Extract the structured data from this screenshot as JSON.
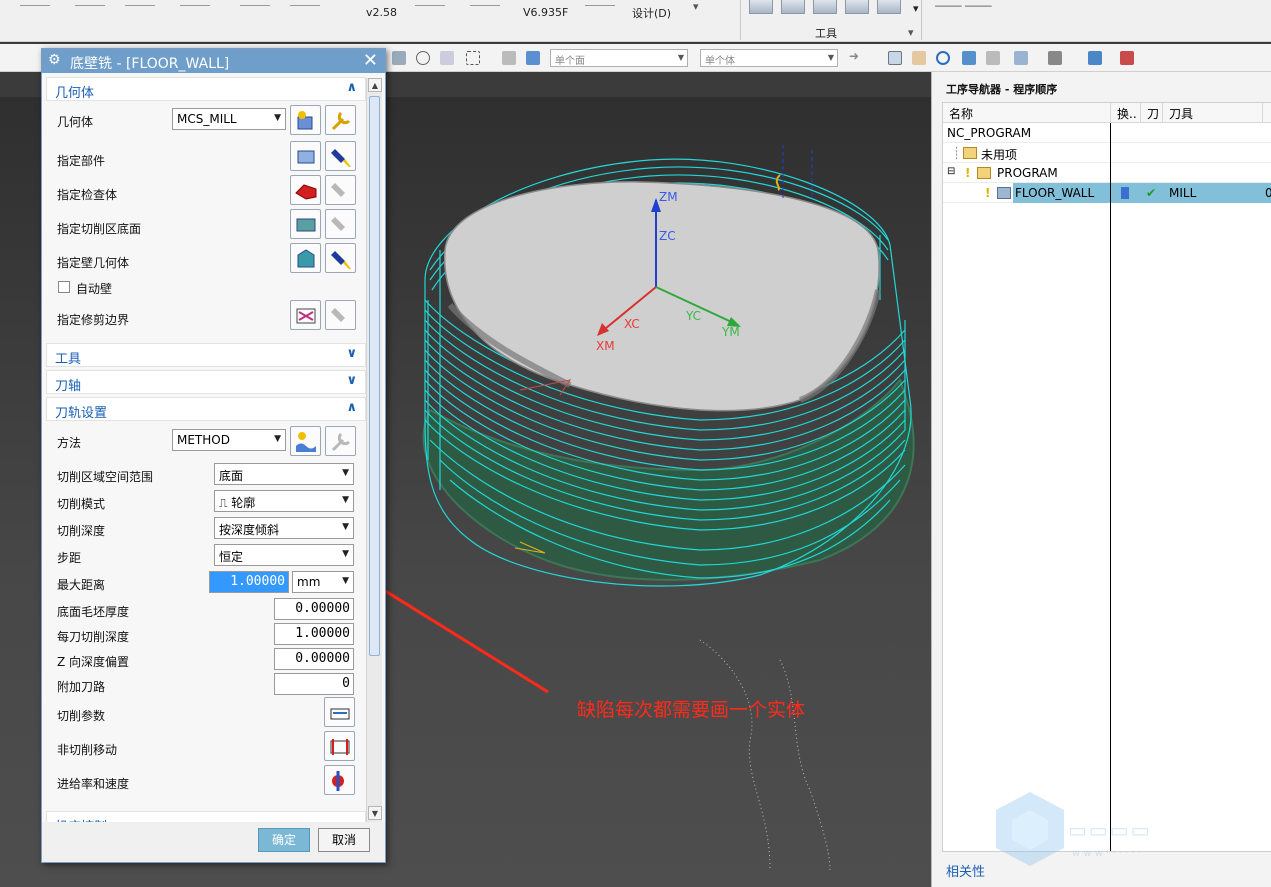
{
  "ribbon": {
    "cam_version": "v2.58",
    "other_version": "V6.935F",
    "design_label": "设计(D)",
    "tools_group_label": "工具"
  },
  "toolbar2": {
    "filter_face": "单个面",
    "filter_body": "单个体"
  },
  "dialog": {
    "title": "底壁铣 - [FLOOR_WALL]",
    "geometry_section": "几何体",
    "geometry_label": "几何体",
    "geometry_value": "MCS_MILL",
    "specify_part": "指定部件",
    "specify_check": "指定检查体",
    "specify_floor": "指定切削区底面",
    "specify_wall": "指定壁几何体",
    "auto_wall": "自动壁",
    "specify_trim": "指定修剪边界",
    "tool_section": "工具",
    "axis_section": "刀轴",
    "path_section": "刀轨设置",
    "method_label": "方法",
    "method_value": "METHOD",
    "cut_region_label": "切削区域空间范围",
    "cut_region_value": "底面",
    "cut_pattern_label": "切削模式",
    "cut_pattern_value": "轮廓",
    "cut_depth_label": "切削深度",
    "cut_depth_value": "按深度倾斜",
    "stepover_label": "步距",
    "stepover_value": "恒定",
    "max_dist_label": "最大距离",
    "max_dist_value": "1.00000",
    "max_dist_unit": "mm",
    "floor_stock_label": "底面毛坯厚度",
    "floor_stock_value": "0.00000",
    "depth_per_cut_label": "每刀切削深度",
    "depth_per_cut_value": "1.00000",
    "z_offset_label": "Z 向深度偏置",
    "z_offset_value": "0.00000",
    "extra_passes_label": "附加刀路",
    "extra_passes_value": "0",
    "cut_params_label": "切削参数",
    "non_cut_label": "非切削移动",
    "feeds_label": "进给率和速度",
    "partial_label": "机床控制",
    "ok": "确定",
    "cancel": "取消"
  },
  "viewport": {
    "annotation": "缺陷每次都需要画一个实体",
    "axes": {
      "zm": "ZM",
      "zc": "ZC",
      "xc": "XC",
      "xm": "XM",
      "yc": "YC",
      "ym": "YM"
    }
  },
  "navigator": {
    "title": "工序导航器 - 程序顺序",
    "col_name": "名称",
    "col_change": "换..",
    "col_path": "刀",
    "col_tool": "刀具",
    "rows": [
      {
        "name": "NC_PROGRAM"
      },
      {
        "name": "未用项"
      },
      {
        "name": "PROGRAM"
      },
      {
        "name": "FLOOR_WALL",
        "tool": "MILL",
        "extra": "0"
      }
    ],
    "footer": "相关性"
  }
}
